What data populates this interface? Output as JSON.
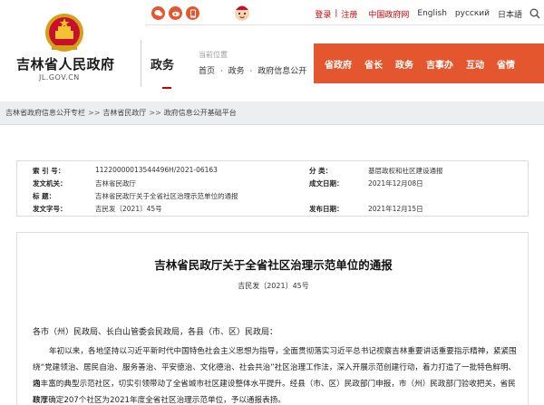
{
  "header": {
    "site_name": "吉林省人民政府",
    "site_domain": "JL.GOV.CN",
    "section_title": "政务",
    "location_label": "当前位置",
    "breadcrumb": [
      "首页",
      "·",
      "政务",
      "·",
      "政府信息公开"
    ]
  },
  "toplinks": {
    "login": "登录",
    "separator": "|",
    "register": "注册",
    "gov_site": "中国政府网",
    "languages": [
      "English",
      "русский",
      "日本語"
    ]
  },
  "nav": {
    "items": [
      "省政府",
      "省长",
      "政务",
      "吉事办",
      "互动",
      "省情"
    ]
  },
  "colors": {
    "accent_red": "#c00000",
    "nav_orange": "#e4572e"
  },
  "crumbbar": {
    "items": [
      "吉林省政府信息公开专栏",
      ">>",
      "吉林省民政厅",
      ">>",
      "政府信息公开基础平台"
    ]
  },
  "meta": {
    "index_label": "索 引 号：",
    "index_value": "11220000013544496H/2021-06163",
    "category_label": "分 类：",
    "category_value": "基层政权和社区建设通报",
    "publisher_label": "发文机关：",
    "publisher_value": "吉林省民政厅",
    "created_label": "成文日期：",
    "created_value": "2021年12月08日",
    "title_label": "标 题：",
    "title_value": "吉林省民政厅关于全省社区治理示范单位的通报",
    "docno_label": "发文字号：",
    "docno_value": "吉民发〔2021〕45号",
    "published_label": "发布日期：",
    "published_value": "2021年12月15日"
  },
  "article": {
    "title": "吉林省民政厅关于全省社区治理示范单位的通报",
    "doc_number": "吉民发〔2021〕45号",
    "greeting": "各市（州）民政局、长白山管委会民政局，各县（市、区）民政局：",
    "para1_lines": [
      "年初以来，各地坚持以习近平新时代中国特色社会主义思想为指导，全面贯彻落实习近平总书记视察吉林重要讲话重要指示精神，紧紧围",
      "绕“党建领治、居民自治、服务善治、平安徳治、文化德治、社会共治”社区治理工作法，深入开展示范创建行动，着力打造了一批特色鲜明、内",
      "涵丰富的典型示范社区，切实引领带动了全省城市社区建设整体水平提升。经县（市、区）民政部门申报，市（州）民政部门验收把关，省民政厅",
      "核准确定207个社区为2021年度全省社区治理示范单位，予以通报表扬。"
    ]
  }
}
